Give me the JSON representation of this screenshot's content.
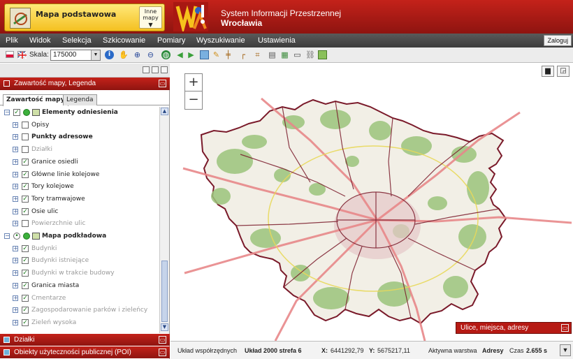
{
  "header": {
    "basemap_title": "Mapa podstawowa",
    "other_maps_line1": "Inne",
    "other_maps_line2": "mapy",
    "system_title_line1": "System Informacji Przestrzennej",
    "system_title_line2": "Wrocławia"
  },
  "menu": {
    "items": [
      "Plik",
      "Widok",
      "Selekcja",
      "Szkicowanie",
      "Pomiary",
      "Wyszukiwanie",
      "Ustawienia"
    ],
    "login": "Zaloguj"
  },
  "toolbar": {
    "scale_label": "Skala:",
    "scale_value": "175000",
    "icons": [
      "info-icon",
      "pan-hand-icon",
      "zoom-in-icon",
      "zoom-out-icon",
      "globe-icon",
      "back-arrow-icon",
      "forward-arrow-icon",
      "map-icon",
      "pencil-icon",
      "measure-line-icon",
      "measure-angle-icon",
      "crop-icon",
      "layers-icon",
      "wms-icon",
      "print-icon",
      "link-icon",
      "export-icon"
    ]
  },
  "left_panel": {
    "header_title": "Zawartość mapy, Legenda",
    "tabs": [
      "Zawartość mapy",
      "Legenda"
    ],
    "tree": [
      {
        "label": "Elementy odniesienia",
        "level": 0,
        "checked": true,
        "bold": true,
        "grey": false,
        "group": true
      },
      {
        "label": "Opisy",
        "level": 1,
        "checked": false,
        "bold": false,
        "grey": false
      },
      {
        "label": "Punkty adresowe",
        "level": 1,
        "checked": false,
        "bold": true,
        "grey": false
      },
      {
        "label": "Działki",
        "level": 1,
        "checked": false,
        "bold": false,
        "grey": true
      },
      {
        "label": "Granice osiedli",
        "level": 1,
        "checked": true,
        "bold": false,
        "grey": false
      },
      {
        "label": "Główne linie kolejowe",
        "level": 1,
        "checked": true,
        "bold": false,
        "grey": false
      },
      {
        "label": "Tory kolejowe",
        "level": 1,
        "checked": true,
        "bold": false,
        "grey": false
      },
      {
        "label": "Tory tramwajowe",
        "level": 1,
        "checked": true,
        "bold": false,
        "grey": false
      },
      {
        "label": "Osie ulic",
        "level": 1,
        "checked": true,
        "bold": false,
        "grey": false
      },
      {
        "label": "Powierzchnie ulic",
        "level": 1,
        "checked": false,
        "bold": false,
        "grey": true
      },
      {
        "label": "Mapa podkładowa",
        "level": 0,
        "checked": true,
        "bold": true,
        "grey": false,
        "group": true,
        "radio": true
      },
      {
        "label": "Budynki",
        "level": 1,
        "checked": true,
        "bold": false,
        "grey": true
      },
      {
        "label": "Budynki istniejące",
        "level": 1,
        "checked": true,
        "bold": false,
        "grey": true
      },
      {
        "label": "Budynki w trakcie budowy",
        "level": 1,
        "checked": true,
        "bold": false,
        "grey": true
      },
      {
        "label": "Granica miasta",
        "level": 1,
        "checked": true,
        "bold": false,
        "grey": false
      },
      {
        "label": "Cmentarze",
        "level": 1,
        "checked": true,
        "bold": false,
        "grey": true
      },
      {
        "label": "Zagospodarowanie parków i zieleńcy",
        "level": 1,
        "checked": true,
        "bold": false,
        "grey": true
      },
      {
        "label": "Zieleń wysoka",
        "level": 1,
        "checked": true,
        "bold": false,
        "grey": true
      }
    ],
    "bottom_panels": [
      "Działki",
      "Obiekty użyteczności publicznej (POI)"
    ]
  },
  "map": {
    "zoom_in": "+",
    "zoom_out": "−",
    "search_panel": "Ulice, miejsca, adresy"
  },
  "status": {
    "coord_label": "Układ współrzędnych",
    "coord_value": "Układ 2000 strefa 6",
    "x_label": "X:",
    "x_value": "6441292,79",
    "y_label": "Y:",
    "y_value": "5675217,11",
    "layer_label": "Aktywna warstwa",
    "layer_value": "Adresy",
    "time_label": "Czas",
    "time_value": "2.655 s"
  },
  "colors": {
    "brand_red": "#b61a14",
    "basemap_yellow": "#f4c020",
    "city_boundary": "#7a1a2a",
    "railway": "#e8888a",
    "green_area": "#9cc47c"
  }
}
